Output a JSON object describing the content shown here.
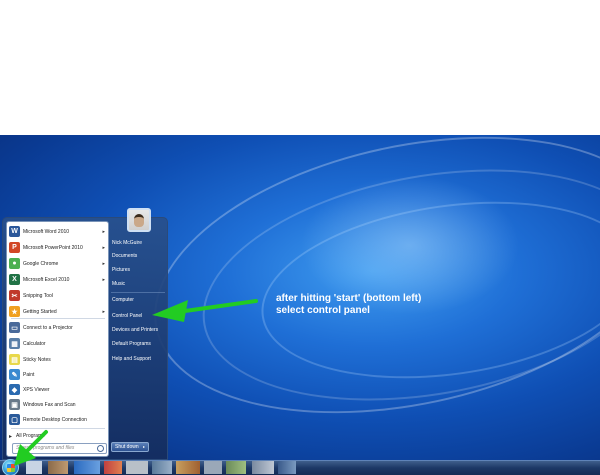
{
  "left_pane": {
    "programs": [
      {
        "label": "Microsoft Word 2010",
        "icon": "word-icon",
        "color": "#2b579a",
        "glyph": "W",
        "has_submenu": true
      },
      {
        "label": "Microsoft PowerPoint 2010",
        "icon": "powerpoint-icon",
        "color": "#d24726",
        "glyph": "P",
        "has_submenu": true
      },
      {
        "label": "Google Chrome",
        "icon": "chrome-icon",
        "color": "#4caf50",
        "glyph": "●",
        "has_submenu": true
      },
      {
        "label": "Microsoft Excel 2010",
        "icon": "excel-icon",
        "color": "#217346",
        "glyph": "X",
        "has_submenu": true
      },
      {
        "label": "Snipping Tool",
        "icon": "scissors-icon",
        "color": "#c0392b",
        "glyph": "✂",
        "has_submenu": false
      },
      {
        "label": "Getting Started",
        "icon": "getting-started-icon",
        "color": "#f0a020",
        "glyph": "★",
        "has_submenu": true
      },
      {
        "label": "Connect to a Projector",
        "icon": "projector-icon",
        "color": "#4a6a9a",
        "glyph": "▭",
        "has_submenu": false
      },
      {
        "label": "Calculator",
        "icon": "calculator-icon",
        "color": "#5a7fa8",
        "glyph": "▦",
        "has_submenu": false
      },
      {
        "label": "Sticky Notes",
        "icon": "sticky-notes-icon",
        "color": "#e8d84a",
        "glyph": "▤",
        "has_submenu": false
      },
      {
        "label": "Paint",
        "icon": "paint-icon",
        "color": "#3a8ad0",
        "glyph": "✎",
        "has_submenu": false
      },
      {
        "label": "XPS Viewer",
        "icon": "xps-viewer-icon",
        "color": "#2a6ab0",
        "glyph": "◆",
        "has_submenu": false
      },
      {
        "label": "Windows Fax and Scan",
        "icon": "fax-icon",
        "color": "#6a7a8a",
        "glyph": "▣",
        "has_submenu": false
      },
      {
        "label": "Remote Desktop Connection",
        "icon": "remote-desktop-icon",
        "color": "#2a5a9a",
        "glyph": "▢",
        "has_submenu": false
      }
    ],
    "all_programs": "All Programs",
    "search_placeholder": "Search programs and files"
  },
  "right_pane": {
    "user_name": "Nick McGuire",
    "links": [
      "Documents",
      "Pictures",
      "Music",
      "Computer",
      "Control Panel",
      "Devices and Printers",
      "Default Programs",
      "Help and Support"
    ],
    "shutdown": "Shut down"
  },
  "annotation": {
    "line1": "after hitting 'start' (bottom left)",
    "line2": "select control panel",
    "arrow_color": "#22cc22"
  }
}
